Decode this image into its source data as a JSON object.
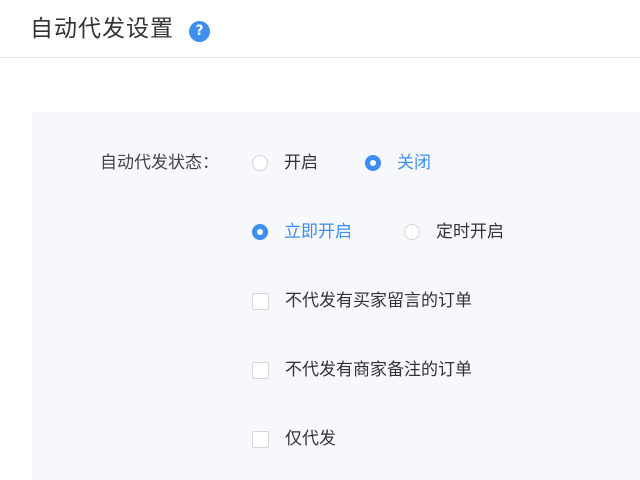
{
  "header": {
    "title": "自动代发设置",
    "help_icon_glyph": "?"
  },
  "settings": {
    "status_label": "自动代发状态：",
    "status_options": [
      {
        "label": "开启",
        "selected": false
      },
      {
        "label": "关闭",
        "selected": true
      }
    ],
    "start_options": [
      {
        "label": "立即开启",
        "selected": true
      },
      {
        "label": "定时开启",
        "selected": false
      }
    ],
    "checkboxes": [
      {
        "label": "不代发有买家留言的订单",
        "checked": false
      },
      {
        "label": "不代发有商家备注的订单",
        "checked": false
      },
      {
        "label": "仅代发",
        "checked": false
      }
    ]
  },
  "colors": {
    "accent": "#3c8ff0",
    "panel_bg": "#f6f8fb",
    "border": "#d3d7de"
  }
}
